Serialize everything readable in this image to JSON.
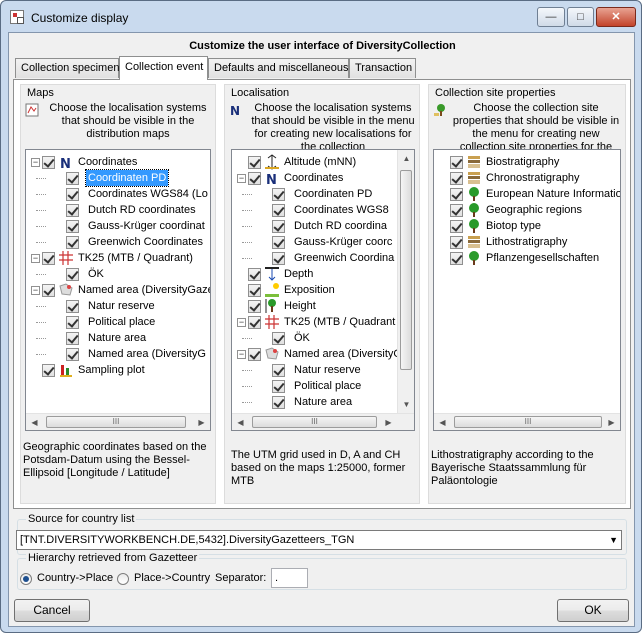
{
  "window": {
    "title": "Customize display",
    "minimize": "—",
    "maximize": "□",
    "close": "✕"
  },
  "heading": "Customize the user interface of DiversityCollection",
  "tabs": [
    "Collection specimen",
    "Collection event",
    "Defaults and miscellaneous",
    "Transaction"
  ],
  "maps": {
    "label": "Maps",
    "description": "Choose the localisation systems that should be visible in the distribution maps",
    "tree": [
      {
        "text": "Coordinates"
      },
      {
        "text": "Coordinaten PD"
      },
      {
        "text": "Coordinates WGS84 (Lo"
      },
      {
        "text": "Dutch RD coordinates"
      },
      {
        "text": "Gauss-Krüger coordinat"
      },
      {
        "text": "Greenwich Coordinates"
      },
      {
        "text": "TK25 (MTB / Quadrant)"
      },
      {
        "text": "ÖK"
      },
      {
        "text": "Named area (DiversityGaze"
      },
      {
        "text": "Natur reserve"
      },
      {
        "text": "Political place"
      },
      {
        "text": "Nature area"
      },
      {
        "text": "Named area (DiversityG"
      },
      {
        "text": "Sampling plot"
      }
    ],
    "note": "Geographic coordinates based on the Potsdam-Datum using the Bessel-Ellipsoid [Longitude / Latitude]"
  },
  "localisation": {
    "label": "Localisation",
    "description": "Choose the localisation systems that should be visible in the menu for creating new localisations for the collection",
    "tree": [
      {
        "text": "Altitude (mNN)"
      },
      {
        "text": "Coordinates"
      },
      {
        "text": "Coordinaten PD"
      },
      {
        "text": "Coordinates WGS8"
      },
      {
        "text": "Dutch RD coordina"
      },
      {
        "text": "Gauss-Krüger coorc"
      },
      {
        "text": "Greenwich Coordina"
      },
      {
        "text": "Depth"
      },
      {
        "text": "Exposition"
      },
      {
        "text": "Height"
      },
      {
        "text": "TK25 (MTB / Quadrant"
      },
      {
        "text": "ÖK"
      },
      {
        "text": "Named area (DiversityG"
      },
      {
        "text": "Natur reserve"
      },
      {
        "text": "Political place"
      },
      {
        "text": "Nature area"
      }
    ],
    "note": "The UTM grid used in D, A and CH based on the maps 1:25000, former MTB"
  },
  "site": {
    "label": "Collection site properties",
    "description": "Choose the collection site properties that should be visible in the menu for creating new collection site properties for the",
    "tree": [
      {
        "text": "Biostratigraphy"
      },
      {
        "text": "Chronostratigraphy"
      },
      {
        "text": "European Nature Information Sy"
      },
      {
        "text": "Geographic regions"
      },
      {
        "text": "Biotop type"
      },
      {
        "text": "Lithostratigraphy"
      },
      {
        "text": "Pflanzengesellschaften"
      }
    ],
    "note": "Lithostratigraphy according to the Bayerische Staatssammlung für Paläontologie"
  },
  "country_source": {
    "label": "Source for country list",
    "value": "[TNT.DIVERSITYWORKBENCH.DE,5432].DiversityGazetteers_TGN"
  },
  "hierarchy": {
    "label": "Hierarchy retrieved from Gazetteer",
    "option1": "Country->Place",
    "option2": "Place->Country",
    "selected": "Country->Place",
    "separator_label": "Separator:",
    "separator_value": "."
  },
  "buttons": {
    "cancel": "Cancel",
    "ok": "OK"
  },
  "scroll": {
    "grip": "III",
    "left": "◀",
    "right": "▶",
    "up": "▲",
    "down": "▼"
  },
  "colors": {
    "selection": "#3399ff",
    "window_frame": "#c9daee",
    "dialog_bg": "#f0f0f0"
  }
}
